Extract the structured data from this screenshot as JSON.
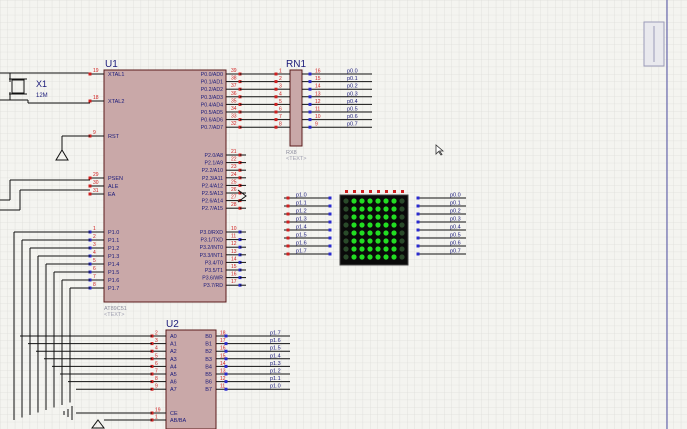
{
  "colors": {
    "background": "#f4f4f0",
    "grid": "#dcdcd8",
    "chip_fill": "#c9a8a8",
    "chip_stroke": "#5a1a1a",
    "wire": "#111111",
    "pin_blue": "#2a2ad0",
    "pin_red": "#d02020",
    "label": "#1a1a7a",
    "led_on": "#22dd22",
    "led_off": "#2a4a2a",
    "matrix_bg": "#0a0a0a",
    "panel_border": "#6a6ab0"
  },
  "icons": {
    "ground": "ground-icon",
    "crystal": "crystal-icon",
    "cursor": "mouse-cursor-icon",
    "toolbar_button": "toolbar-button-icon"
  },
  "x1": {
    "ref": "X1",
    "value": "12M"
  },
  "u1": {
    "ref": "U1",
    "part": "AT89C51",
    "hidden_text": "<TEXT>",
    "left_pins": [
      {
        "num": "19",
        "name": "XTAL1"
      },
      {
        "num": "18",
        "name": "XTAL2"
      },
      {
        "num": "9",
        "name": "RST"
      },
      {
        "num": "29",
        "name": "PSEN"
      },
      {
        "num": "30",
        "name": "ALE"
      },
      {
        "num": "31",
        "name": "EA"
      },
      {
        "num": "1",
        "name": "P1.0"
      },
      {
        "num": "2",
        "name": "P1.1"
      },
      {
        "num": "3",
        "name": "P1.2"
      },
      {
        "num": "4",
        "name": "P1.3"
      },
      {
        "num": "5",
        "name": "P1.4"
      },
      {
        "num": "6",
        "name": "P1.5"
      },
      {
        "num": "7",
        "name": "P1.6"
      },
      {
        "num": "8",
        "name": "P1.7"
      }
    ],
    "right_pins": [
      {
        "num": "39",
        "name": "P0.0/AD0"
      },
      {
        "num": "38",
        "name": "P0.1/AD1"
      },
      {
        "num": "37",
        "name": "P0.2/AD2"
      },
      {
        "num": "36",
        "name": "P0.3/AD3"
      },
      {
        "num": "35",
        "name": "P0.4/AD4"
      },
      {
        "num": "34",
        "name": "P0.5/AD5"
      },
      {
        "num": "33",
        "name": "P0.6/AD6"
      },
      {
        "num": "32",
        "name": "P0.7/AD7"
      },
      {
        "num": "21",
        "name": "P2.0/A8"
      },
      {
        "num": "22",
        "name": "P2.1/A9"
      },
      {
        "num": "23",
        "name": "P2.2/A10"
      },
      {
        "num": "24",
        "name": "P2.3/A11"
      },
      {
        "num": "25",
        "name": "P2.4/A12"
      },
      {
        "num": "26",
        "name": "P2.5/A13"
      },
      {
        "num": "27",
        "name": "P2.6/A14"
      },
      {
        "num": "28",
        "name": "P2.7/A15"
      },
      {
        "num": "10",
        "name": "P3.0/RXD"
      },
      {
        "num": "11",
        "name": "P3.1/TXD"
      },
      {
        "num": "12",
        "name": "P3.2/INT0"
      },
      {
        "num": "13",
        "name": "P3.3/INT1"
      },
      {
        "num": "14",
        "name": "P3.4/T0"
      },
      {
        "num": "15",
        "name": "P3.5/T1"
      },
      {
        "num": "16",
        "name": "P3.6/WR"
      },
      {
        "num": "17",
        "name": "P3.7/RD"
      }
    ]
  },
  "rn1": {
    "ref": "RN1",
    "part": "RX8",
    "hidden_text": "<TEXT>",
    "left_nums": [
      "1",
      "2",
      "3",
      "4",
      "5",
      "6",
      "7",
      "8"
    ],
    "right_nums": [
      "16",
      "15",
      "14",
      "13",
      "12",
      "11",
      "10",
      "9"
    ],
    "nets": [
      "p0.0",
      "p0.1",
      "p0.2",
      "p0.3",
      "p0.4",
      "p0.5",
      "p0.6",
      "p0.7"
    ]
  },
  "matrix": {
    "left_nets": [
      "p1.0",
      "p1.1",
      "p1.2",
      "p1.3",
      "p1.4",
      "p1.5",
      "p1.6",
      "p1.7"
    ],
    "right_nets": [
      "p0.0",
      "p0.1",
      "p0.2",
      "p0.3",
      "p0.4",
      "p0.5",
      "p0.6",
      "p0.7"
    ],
    "leds_on": [
      [
        0,
        1,
        1,
        1,
        1,
        1,
        1,
        0
      ],
      [
        0,
        1,
        1,
        1,
        1,
        1,
        1,
        0
      ],
      [
        0,
        1,
        1,
        1,
        1,
        1,
        1,
        0
      ],
      [
        0,
        1,
        1,
        1,
        1,
        1,
        1,
        0
      ],
      [
        0,
        1,
        1,
        1,
        1,
        1,
        1,
        0
      ],
      [
        0,
        1,
        1,
        1,
        1,
        1,
        1,
        0
      ],
      [
        0,
        1,
        1,
        1,
        1,
        1,
        1,
        0
      ],
      [
        0,
        1,
        1,
        1,
        1,
        1,
        1,
        0
      ]
    ]
  },
  "u2": {
    "ref": "U2",
    "left_pins": [
      {
        "num": "2",
        "name": "A0"
      },
      {
        "num": "3",
        "name": "A1"
      },
      {
        "num": "4",
        "name": "A2"
      },
      {
        "num": "5",
        "name": "A3"
      },
      {
        "num": "6",
        "name": "A4"
      },
      {
        "num": "7",
        "name": "A5"
      },
      {
        "num": "8",
        "name": "A6"
      },
      {
        "num": "9",
        "name": "A7"
      }
    ],
    "right_pins": [
      {
        "num": "18",
        "name": "B0"
      },
      {
        "num": "17",
        "name": "B1"
      },
      {
        "num": "16",
        "name": "B2"
      },
      {
        "num": "15",
        "name": "B3"
      },
      {
        "num": "14",
        "name": "B4"
      },
      {
        "num": "13",
        "name": "B5"
      },
      {
        "num": "12",
        "name": "B6"
      },
      {
        "num": "11",
        "name": "B7"
      }
    ],
    "nets": [
      "p1.7",
      "p1.6",
      "p1.5",
      "p1.4",
      "p1.3",
      "p1.2",
      "p1.1",
      "p1.0"
    ],
    "ctrl_pins": [
      {
        "num": "19",
        "name": "CE"
      },
      {
        "num": "1",
        "name": "AB/BA"
      }
    ]
  }
}
